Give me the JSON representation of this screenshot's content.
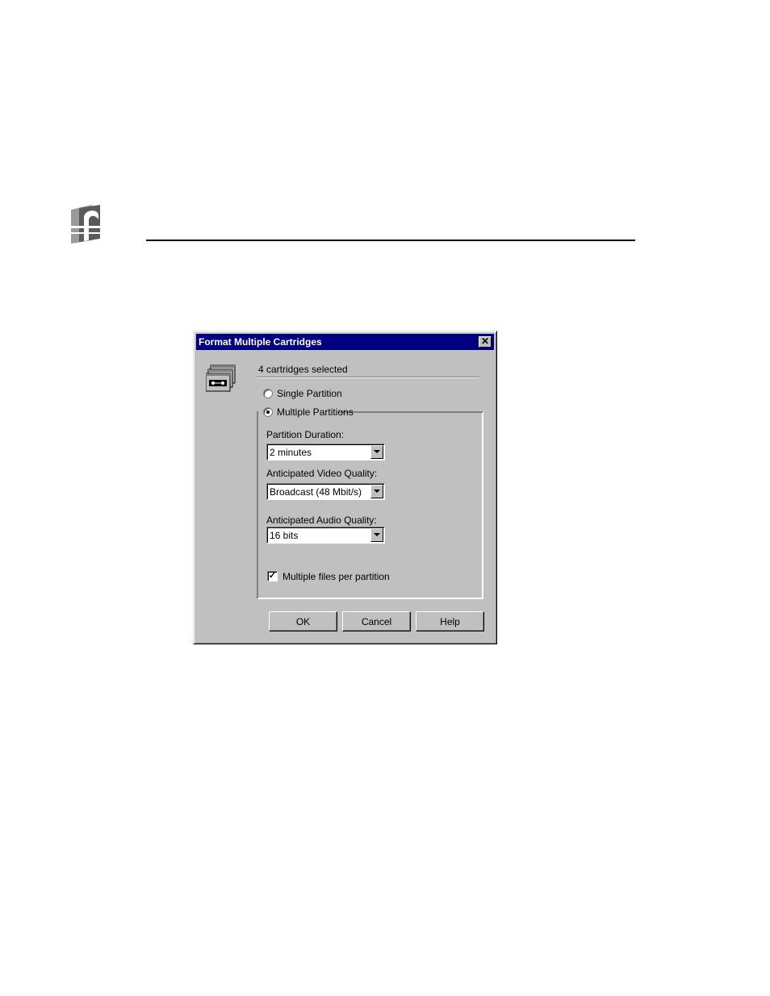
{
  "dialog": {
    "title": "Format Multiple Cartridges",
    "close_glyph": "✕",
    "icon": "tape-cartridge-icon",
    "selection_text": "4 cartridges selected",
    "single_partition_label": "Single Partition",
    "multiple_partitions_label": "Multiple Partitions",
    "selected_option": "multiple_partitions",
    "partition_duration": {
      "label": "Partition Duration:",
      "value": "2 minutes"
    },
    "video_quality": {
      "label": "Anticipated Video Quality:",
      "value": "Broadcast (48 Mbit/s)"
    },
    "audio_quality": {
      "label": "Anticipated Audio Quality:",
      "value": "16 bits"
    },
    "multiple_files": {
      "label": "Multiple files per partition",
      "checked": true,
      "check_glyph": "✓"
    },
    "buttons": {
      "ok": "OK",
      "cancel": "Cancel",
      "help": "Help"
    }
  },
  "colors": {
    "dialog_face": "#c0c0c0",
    "title_bar": "#000080",
    "title_text": "#ffffff"
  }
}
